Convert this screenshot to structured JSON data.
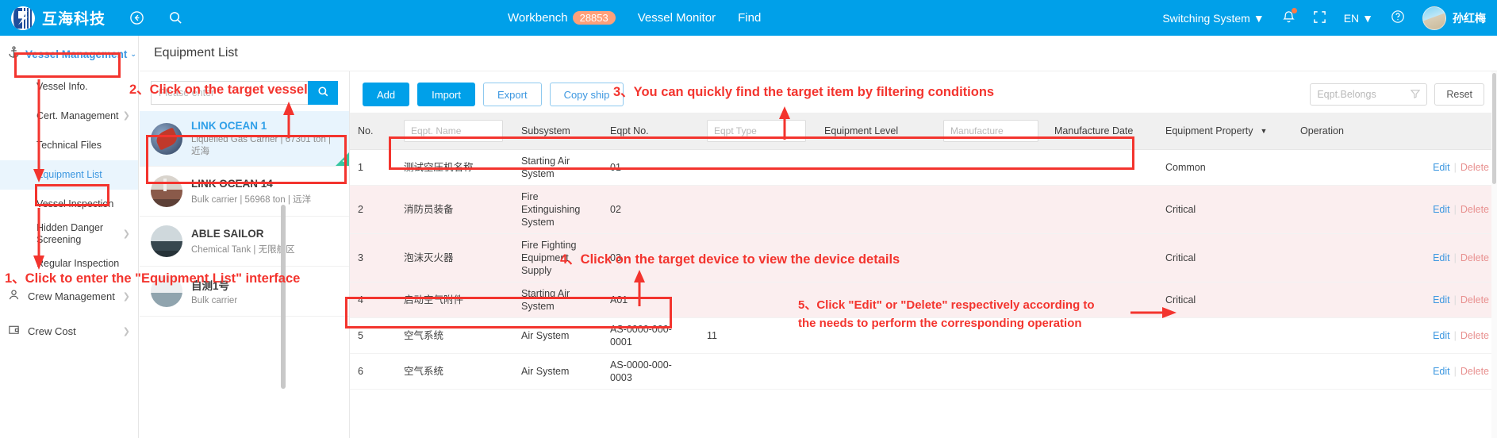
{
  "topbar": {
    "logo_text": "互海科技",
    "back_icon": "back-circle-icon",
    "search_icon": "search-icon",
    "workbench_label": "Workbench",
    "workbench_count": "28853",
    "vessel_monitor_label": "Vessel Monitor",
    "find_label": "Find",
    "switching_system_label": "Switching System",
    "bell_icon": "bell-icon",
    "fullscreen_icon": "fullscreen-icon",
    "language_label": "EN",
    "help_icon": "help-circle-icon",
    "user_name": "孙红梅"
  },
  "sidebar": {
    "group": {
      "label": "Vessel Management",
      "icon": "anchor-icon"
    },
    "items": [
      {
        "label": "Vessel Info.",
        "has_chevron": false
      },
      {
        "label": "Cert. Management",
        "has_chevron": true
      },
      {
        "label": "Technical Files",
        "has_chevron": false
      },
      {
        "label": "Equipment List",
        "has_chevron": false,
        "active": true
      },
      {
        "label": "Vessel Inspection",
        "has_chevron": false
      },
      {
        "label": "Hidden Danger Screening",
        "has_chevron": true
      },
      {
        "label": "Regular Inspection",
        "has_chevron": false
      }
    ],
    "parents": [
      {
        "label": "Crew Management",
        "icon": "person-icon"
      },
      {
        "label": "Crew Cost",
        "icon": "wallet-icon"
      }
    ]
  },
  "vessel_panel": {
    "search_placeholder": "Please enter",
    "search_icon": "search-icon",
    "vessels": [
      {
        "name": "LINK OCEAN 1",
        "meta": "Liquefied Gas Carrier | 67301 ton | 近海",
        "selected": true,
        "thumb": "t1"
      },
      {
        "name": "LINK OCEAN 14",
        "meta": "Bulk carrier | 56968 ton | 远洋",
        "selected": false,
        "thumb": "t2"
      },
      {
        "name": "ABLE SAILOR",
        "meta": "Chemical Tank | 无限航区",
        "selected": false,
        "thumb": "t3"
      },
      {
        "name": "自测1号",
        "meta": "Bulk carrier",
        "selected": false,
        "thumb": "t4"
      }
    ]
  },
  "main": {
    "page_title": "Equipment List",
    "buttons": {
      "add": "Add",
      "import": "Import",
      "export": "Export",
      "copy_ship": "Copy ship"
    },
    "filter": {
      "eqpt_belongs_placeholder": "Eqpt.Belongs",
      "filter_icon": "filter-icon",
      "reset_label": "Reset"
    },
    "table": {
      "columns": [
        {
          "key": "no",
          "label": "No.",
          "type": "text"
        },
        {
          "key": "name",
          "label": "",
          "type": "input",
          "placeholder": "Eqpt. Name"
        },
        {
          "key": "subsystem",
          "label": "Subsystem",
          "type": "text"
        },
        {
          "key": "eqpt_no",
          "label": "Eqpt No.",
          "type": "text"
        },
        {
          "key": "eqpt_type",
          "label": "",
          "type": "input",
          "placeholder": "Eqpt Type"
        },
        {
          "key": "level",
          "label": "Equipment Level",
          "type": "text"
        },
        {
          "key": "manufacture",
          "label": "",
          "type": "input",
          "placeholder": "Manufacture"
        },
        {
          "key": "manufacture_date",
          "label": "Manufacture Date",
          "type": "text"
        },
        {
          "key": "property",
          "label": "Equipment Property",
          "type": "select"
        },
        {
          "key": "operation",
          "label": "Operation",
          "type": "text"
        }
      ],
      "rows": [
        {
          "no": "1",
          "name": "测试空压机名称",
          "subsystem": "Starting Air System",
          "eqpt_no": "01",
          "eqpt_type": "",
          "level": "",
          "manufacture": "",
          "manufacture_date": "",
          "property": "Common",
          "edit": "Edit",
          "delete": "Delete",
          "style": "normal"
        },
        {
          "no": "2",
          "name": "消防员装备",
          "subsystem": "Fire Extinguishing System",
          "eqpt_no": "02",
          "eqpt_type": "",
          "level": "",
          "manufacture": "",
          "manufacture_date": "",
          "property": "Critical",
          "edit": "Edit",
          "delete": "Delete",
          "style": "critical"
        },
        {
          "no": "3",
          "name": "泡沫灭火器",
          "subsystem": "Fire Fighting Equipment Supply",
          "eqpt_no": "03",
          "eqpt_type": "",
          "level": "",
          "manufacture": "",
          "manufacture_date": "",
          "property": "Critical",
          "edit": "Edit",
          "delete": "Delete",
          "style": "critical"
        },
        {
          "no": "4",
          "name": "启动空气附件",
          "subsystem": "Starting Air System",
          "eqpt_no": "A01",
          "eqpt_type": "",
          "level": "",
          "manufacture": "",
          "manufacture_date": "",
          "property": "Critical",
          "edit": "Edit",
          "delete": "Delete",
          "style": "critical"
        },
        {
          "no": "5",
          "name": "空气系统",
          "subsystem": "Air System",
          "eqpt_no": "AS-0000-000-0001",
          "eqpt_type": "11",
          "level": "",
          "manufacture": "",
          "manufacture_date": "",
          "property": "",
          "edit": "Edit",
          "delete": "Delete",
          "style": "normal"
        },
        {
          "no": "6",
          "name": "空气系统",
          "subsystem": "Air System",
          "eqpt_no": "AS-0000-000-0003",
          "eqpt_type": "",
          "level": "",
          "manufacture": "",
          "manufacture_date": "",
          "property": "",
          "edit": "Edit",
          "delete": "Delete",
          "style": "normal"
        }
      ]
    }
  },
  "annotations": [
    {
      "id": "a1",
      "text": "1、Click to enter the \"Equipment List\" interface"
    },
    {
      "id": "a2",
      "text": "2、Click on the target vessel"
    },
    {
      "id": "a3",
      "text": "3、You can quickly find the target item by filtering conditions"
    },
    {
      "id": "a4",
      "text": "4、Click on the target device to view the device details"
    },
    {
      "id": "a5_line1",
      "text": "5、Click \"Edit\" or \"Delete\" respectively according to"
    },
    {
      "id": "a5_line2",
      "text": "the needs to perform the corresponding operation"
    }
  ],
  "colors": {
    "brand_blue": "#00A0E9",
    "annotation_red": "#F3342E",
    "critical_row_bg": "#FBEEEF",
    "selected_vessel_bg": "#E8F4FD"
  }
}
